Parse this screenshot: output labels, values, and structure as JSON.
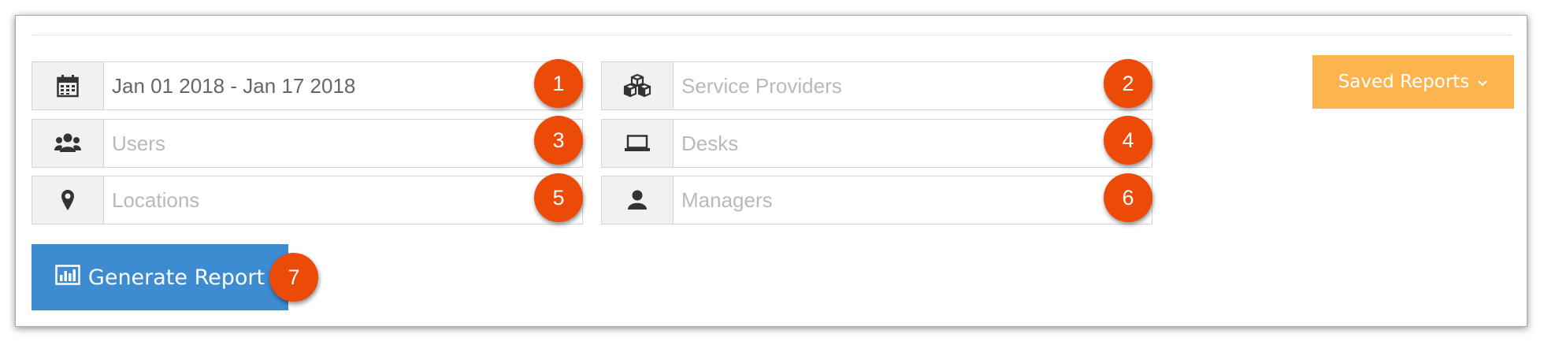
{
  "filters": {
    "date_range": {
      "value": "Jan 01 2018 - Jan 17 2018",
      "icon": "calendar-icon",
      "badge": "1"
    },
    "service_providers": {
      "placeholder": "Service Providers",
      "icon": "cubes-icon",
      "badge": "2"
    },
    "users": {
      "placeholder": "Users",
      "icon": "users-icon",
      "badge": "3"
    },
    "desks": {
      "placeholder": "Desks",
      "icon": "laptop-icon",
      "badge": "4"
    },
    "locations": {
      "placeholder": "Locations",
      "icon": "map-marker-icon",
      "badge": "5"
    },
    "managers": {
      "placeholder": "Managers",
      "icon": "user-icon",
      "badge": "6"
    }
  },
  "saved_reports": {
    "label": "Saved Reports",
    "icon": "chevron-down-icon",
    "color": "#fcb44f"
  },
  "generate_report": {
    "label": "Generate Report",
    "icon": "bar-chart-icon",
    "badge": "7",
    "color": "#3d8bd1"
  },
  "colors": {
    "badge": "#ec4a07",
    "placeholder": "#b9b9b9",
    "addon_bg": "#f1f1f1"
  }
}
